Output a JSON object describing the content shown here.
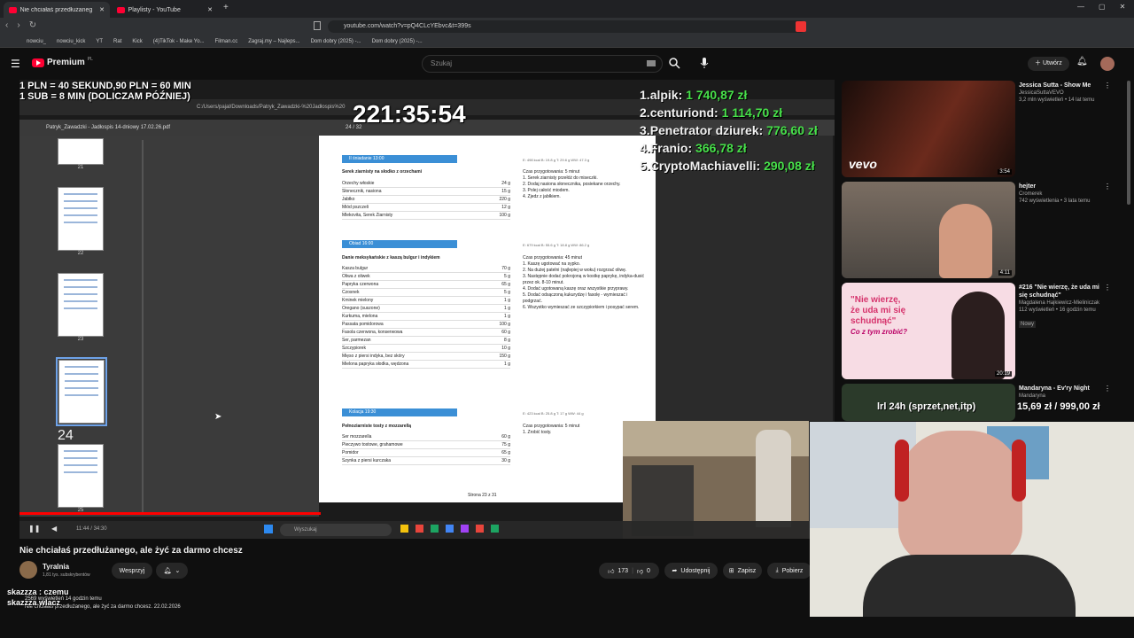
{
  "browser": {
    "tabs": [
      {
        "label": "Nie chciałaś przedłużaneg"
      },
      {
        "label": "Playlisty - YouTube"
      }
    ],
    "url": "youtube.com/watch?v=pQ4CLcYEbvc&t=399s",
    "bookmarks": [
      "nowciu_",
      "nowciu_kick",
      "YT",
      "Rat",
      "Kick",
      "(4)TikTok - Make Yo...",
      "Filman.cc",
      "Zagraj.my – Najleps...",
      "Dom dobry (2025) -...",
      "Dom dobry (2025) -..."
    ]
  },
  "yt": {
    "logo": "Premium",
    "logo_sup": "PL",
    "search_placeholder": "Szukaj",
    "create_label": "Utwórz"
  },
  "overlay": {
    "rate_line1": "1 PLN = 40 SEKUND,90 PLN = 60 MIN",
    "rate_line2": "1 SUB = 8 MIN (DOLICZAM PÓŹNIEJ)",
    "timer": "221:35:54",
    "donors": [
      {
        "rank": "1.",
        "name": "alpik:",
        "amount": "1 740,87 zł"
      },
      {
        "rank": "2.",
        "name": "centuriond:",
        "amount": "1 114,70 zł"
      },
      {
        "rank": "3.",
        "name": "Penetrator dziurek:",
        "amount": "776,60 zł"
      },
      {
        "rank": "4.",
        "name": "Franio:",
        "amount": "366,78 zł"
      },
      {
        "rank": "5.",
        "name": "CryptoMachiavelli:",
        "amount": "290,08 zł"
      }
    ],
    "goal_label": "lrl 24h (sprzet,net,itp)",
    "goal_current": "15,69 zł",
    "goal_target": "999,00 zł"
  },
  "pdf": {
    "path": "C:/Users/pajal/Downloads/Patryk_Zawadzki-%20Jadłospis%20",
    "title": "Patryk_Zawadzki - Jadłospis 14-dniowy 17.02.26.pdf",
    "page_info": "24 / 32",
    "thumbs": [
      "21",
      "22",
      "23",
      "24",
      "25"
    ],
    "meals": [
      {
        "header": "II śniadanie 13:00",
        "kcal": "E: 498 kcal  B: 19.8 g  T: 29.6 g  WW: 47.3 g",
        "name": "Serek ziarnisty na słodko z orzechami",
        "ingredients": [
          {
            "n": "Orzechy włoskie",
            "q": "24 g"
          },
          {
            "n": "Słonecznik, nasiona",
            "q": "15 g"
          },
          {
            "n": "Jabłko",
            "q": "220 g"
          },
          {
            "n": "Miód pszczeli",
            "q": "12 g"
          },
          {
            "n": "Mlekovita, Serek Ziarnisty",
            "q": "100 g"
          }
        ],
        "time": "Czas przygotowania: 5 minut",
        "steps": [
          "1. Serek ziarnisty przełóż do miseczki.",
          "2. Dodaj nasiona słonecznika, posiekane orzechy.",
          "3. Polej całość miodem.",
          "4. Zjedz z jabłkiem."
        ]
      },
      {
        "header": "Obiad 16:00",
        "kcal": "E: 679 kcal  B: 55.6 g  T: 18.8 g  WW: 86.2 g",
        "name": "Danie meksykańskie z kaszą bulgur i indykiem",
        "ingredients": [
          {
            "n": "Kasza bulgur",
            "q": "70 g"
          },
          {
            "n": "Oliwa z oliwek",
            "q": "5 g"
          },
          {
            "n": "Papryka czerwona",
            "q": "65 g"
          },
          {
            "n": "Czosnek",
            "q": "5 g"
          },
          {
            "n": "Kminek mielony",
            "q": "1 g"
          },
          {
            "n": "Oregano (suszone)",
            "q": "1 g"
          },
          {
            "n": "Kurkuma, mielona",
            "q": "1 g"
          },
          {
            "n": "Passata pomidorowa",
            "q": "100 g"
          },
          {
            "n": "Fasola czerwona, konserwowa",
            "q": "60 g"
          },
          {
            "n": "Ser, parmezan",
            "q": "8 g"
          },
          {
            "n": "Szczypiorek",
            "q": "10 g"
          },
          {
            "n": "Mięso z piersi indyka, bez skóry",
            "q": "150 g"
          },
          {
            "n": "Mielona papryka słodka, wędzona",
            "q": "1 g"
          }
        ],
        "time": "Czas przygotowania: 45 minut",
        "steps": [
          "1. Kaszę ugotować na sypko.",
          "2. Na dużej patelni (najlepiej w woku) rozgrzać oliwę.",
          "3. Następnie dodać pokrojoną w kostkę paprykę, indyka-dusić przez ok. 8-10 minut.",
          "4. Dodać ugotowaną kaszę oraz wszystkie przyprawy.",
          "5. Dodać odsączoną kukurydzę i fasolę - wymieszać i podgrzać.",
          "6. Wszystko wymieszać ze szczypiorkiem i posypać serem."
        ]
      },
      {
        "header": "Kolacja 19:30",
        "kcal": "E: 423 kcal  B: 25.8 g  T: 17 g  WW: 44 g",
        "name": "Pełnoziarniste tosty z mozzarellą",
        "ingredients": [
          {
            "n": "Ser mozzarella",
            "q": "60 g"
          },
          {
            "n": "Pieczywo tostowe, grahamowe",
            "q": "75 g"
          },
          {
            "n": "Pomidor",
            "q": "65 g"
          },
          {
            "n": "Szynka z piersi kurczaka",
            "q": "30 g"
          }
        ],
        "time": "Czas przygotowania: 5 minut",
        "steps": [
          "1. Zrobić tosty."
        ]
      }
    ],
    "page_footer": "Strona 23 z 31"
  },
  "taskbar": {
    "search": "Wyszukaj",
    "time_display": "11:44 / 34:30"
  },
  "video_info": {
    "title": "Nie chciałaś przedłużanego, ale żyć za darmo chcesz",
    "channel": "Tyralnia",
    "subs": "1,81 tys. subskrybentów",
    "support_label": "Wesprzyj",
    "likes": "173",
    "dislikes": "0",
    "share_label": "Udostępnij",
    "save_label": "Zapisz",
    "download_label": "Pobierz",
    "views_line": "2569 wyświetleń  14 godzin temu",
    "desc_line": "Nie chciałaś przedłużanego, ale żyć za darmo chcesz. 22.02.2026"
  },
  "chat": [
    {
      "user": "skazzza",
      "msg": ": czemu"
    },
    {
      "user": "skazzza",
      "msg": "wlacz"
    }
  ],
  "sidebar": [
    {
      "title": "Jessica Sutta - Show Me",
      "channel": "JessicaSuttaVEVO",
      "meta": "3,2 mln wyświetleń • 14 lat temu",
      "duration": "3:54",
      "badge": "vevo"
    },
    {
      "title": "hejter",
      "channel": "Cromerek",
      "meta": "742 wyświetlenia • 3 lata temu",
      "duration": "4:11"
    },
    {
      "title": "#216 \"Nie wierzę, że uda mi się schudnąć\"",
      "channel": "Magdalena Hajkiewicz-Mieliniczak",
      "meta": "112 wyświetleń • 16 godzin temu",
      "badge": "Nowy",
      "duration": "20:19",
      "thumb_text1": "\"Nie wierzę,",
      "thumb_text2": "że uda mi się",
      "thumb_text3": "schudnąć\"",
      "thumb_text4": "Co z tym zrobić?"
    },
    {
      "title": "Mandaryna - Ev'ry Night",
      "channel": "Mandaryna"
    }
  ]
}
